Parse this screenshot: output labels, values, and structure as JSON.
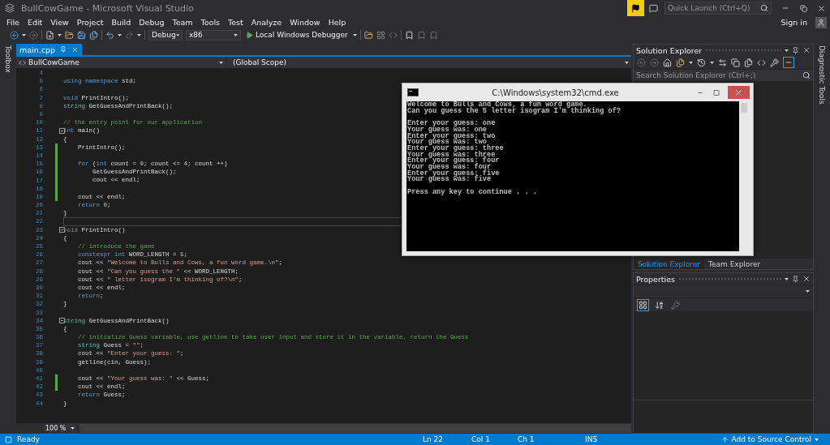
{
  "window": {
    "title": "BullCowGame - Microsoft Visual Studio"
  },
  "quick_launch": {
    "placeholder": "Quick Launch (Ctrl+Q)"
  },
  "sign_in": "Sign in",
  "menu": [
    "File",
    "Edit",
    "View",
    "Project",
    "Build",
    "Debug",
    "Team",
    "Tools",
    "Test",
    "Analyze",
    "Window",
    "Help"
  ],
  "toolbar": {
    "configuration": "Debug",
    "platform": "x86",
    "debugger": "Local Windows Debugger"
  },
  "side_tabs": {
    "left": "Toolbox",
    "right": "Diagnostic Tools"
  },
  "editor": {
    "tabs": [
      {
        "label": "main.cpp",
        "selected": true
      }
    ],
    "project": "BullCowGame",
    "scope": "(Global Scope)",
    "zoom": "100 %",
    "lines": [
      {
        "number": "4",
        "fold": false,
        "changed": false,
        "current": false
      },
      {
        "number": "5",
        "fold": false,
        "changed": false,
        "current": false,
        "tokens": [
          {
            "kind": "kw",
            "text": "using"
          },
          {
            "kind": "kw",
            "text": " namespace"
          },
          {
            "kind": "plain",
            "text": " std;"
          }
        ]
      },
      {
        "number": "6",
        "fold": false,
        "changed": false,
        "current": false
      },
      {
        "number": "7",
        "fold": false,
        "changed": false,
        "current": false,
        "tokens": [
          {
            "kind": "kw",
            "text": "void"
          },
          {
            "kind": "plain",
            "text": " PrintIntro();"
          }
        ]
      },
      {
        "number": "8",
        "fold": false,
        "changed": false,
        "current": false,
        "tokens": [
          {
            "kind": "type",
            "text": "string"
          },
          {
            "kind": "plain",
            "text": " GetGuessAndPrintBack();"
          }
        ]
      },
      {
        "number": "9",
        "fold": false,
        "changed": false,
        "current": false
      },
      {
        "number": "10",
        "fold": false,
        "changed": false,
        "current": false,
        "tokens": [
          {
            "kind": "comment",
            "text": "// the entry point for our application"
          }
        ]
      },
      {
        "number": "11",
        "fold": true,
        "changed": false,
        "current": false,
        "tokens": [
          {
            "kind": "kw",
            "text": "int"
          },
          {
            "kind": "plain",
            "text": " main()"
          }
        ]
      },
      {
        "number": "12",
        "fold": false,
        "changed": false,
        "current": false,
        "tokens": [
          {
            "kind": "plain",
            "text": "{"
          }
        ]
      },
      {
        "number": "13",
        "fold": false,
        "changed": true,
        "current": false,
        "tokens": [
          {
            "kind": "plain",
            "text": "    PrintIntro();"
          }
        ]
      },
      {
        "number": "14",
        "fold": false,
        "changed": true,
        "current": false
      },
      {
        "number": "15",
        "fold": false,
        "changed": true,
        "current": false,
        "tokens": [
          {
            "kind": "kw",
            "text": "    for"
          },
          {
            "kind": "plain",
            "text": " ("
          },
          {
            "kind": "kw",
            "text": "int"
          },
          {
            "kind": "plain",
            "text": " count = "
          },
          {
            "kind": "num",
            "text": "0"
          },
          {
            "kind": "plain",
            "text": "; count <= "
          },
          {
            "kind": "num",
            "text": "4"
          },
          {
            "kind": "plain",
            "text": "; count ++)"
          }
        ]
      },
      {
        "number": "16",
        "fold": false,
        "changed": true,
        "current": false,
        "tokens": [
          {
            "kind": "plain",
            "text": "        GetGuessAndPrintBack();"
          }
        ]
      },
      {
        "number": "17",
        "fold": false,
        "changed": true,
        "current": false,
        "tokens": [
          {
            "kind": "plain",
            "text": "        cout << endl;"
          }
        ]
      },
      {
        "number": "18",
        "fold": false,
        "changed": true,
        "current": false
      },
      {
        "number": "19",
        "fold": false,
        "changed": true,
        "current": false,
        "tokens": [
          {
            "kind": "plain",
            "text": "    cout << endl;"
          }
        ]
      },
      {
        "number": "20",
        "fold": false,
        "changed": false,
        "current": false,
        "tokens": [
          {
            "kind": "kw",
            "text": "    return"
          },
          {
            "kind": "num",
            "text": " 0"
          },
          {
            "kind": "plain",
            "text": ";"
          }
        ]
      },
      {
        "number": "21",
        "fold": false,
        "changed": false,
        "current": false,
        "tokens": [
          {
            "kind": "plain",
            "text": "}"
          }
        ]
      },
      {
        "number": "22",
        "fold": false,
        "changed": false,
        "current": true
      },
      {
        "number": "23",
        "fold": true,
        "changed": false,
        "current": false,
        "tokens": [
          {
            "kind": "kw",
            "text": "void"
          },
          {
            "kind": "plain",
            "text": " PrintIntro()"
          }
        ]
      },
      {
        "number": "24",
        "fold": false,
        "changed": false,
        "current": false,
        "tokens": [
          {
            "kind": "plain",
            "text": "{"
          }
        ]
      },
      {
        "number": "25",
        "fold": false,
        "changed": false,
        "current": false,
        "tokens": [
          {
            "kind": "comment",
            "text": "    // introduce the game"
          }
        ]
      },
      {
        "number": "26",
        "fold": false,
        "changed": false,
        "current": false,
        "tokens": [
          {
            "kind": "kw",
            "text": "    constexpr"
          },
          {
            "kind": "kw",
            "text": " int"
          },
          {
            "kind": "plain",
            "text": " WORD_LENGTH = "
          },
          {
            "kind": "num",
            "text": "5"
          },
          {
            "kind": "plain",
            "text": ";"
          }
        ]
      },
      {
        "number": "27",
        "fold": false,
        "changed": false,
        "current": false,
        "tokens": [
          {
            "kind": "plain",
            "text": "    cout << "
          },
          {
            "kind": "str",
            "text": "\"Welcome to Bulls and Cows, a fun word game.\\n\""
          },
          {
            "kind": "plain",
            "text": ";"
          }
        ]
      },
      {
        "number": "28",
        "fold": false,
        "changed": false,
        "current": false,
        "tokens": [
          {
            "kind": "plain",
            "text": "    cout << "
          },
          {
            "kind": "str",
            "text": "\"Can you guess the \""
          },
          {
            "kind": "plain",
            "text": " << WORD_LENGTH;"
          }
        ]
      },
      {
        "number": "29",
        "fold": false,
        "changed": false,
        "current": false,
        "tokens": [
          {
            "kind": "plain",
            "text": "    cout << "
          },
          {
            "kind": "str",
            "text": "\" letter isogram I'm thinking of?\\n\""
          },
          {
            "kind": "plain",
            "text": ";"
          }
        ]
      },
      {
        "number": "30",
        "fold": false,
        "changed": false,
        "current": false,
        "tokens": [
          {
            "kind": "plain",
            "text": "    cout << endl;"
          }
        ]
      },
      {
        "number": "31",
        "fold": false,
        "changed": false,
        "current": false,
        "tokens": [
          {
            "kind": "kw",
            "text": "    return"
          },
          {
            "kind": "plain",
            "text": ";"
          }
        ]
      },
      {
        "number": "32",
        "fold": false,
        "changed": false,
        "current": false,
        "tokens": [
          {
            "kind": "plain",
            "text": "}"
          }
        ]
      },
      {
        "number": "33",
        "fold": false,
        "changed": false,
        "current": false
      },
      {
        "number": "34",
        "fold": true,
        "changed": false,
        "current": false,
        "tokens": [
          {
            "kind": "type",
            "text": "string"
          },
          {
            "kind": "plain",
            "text": " GetGuessAndPrintBack()"
          }
        ]
      },
      {
        "number": "35",
        "fold": false,
        "changed": false,
        "current": false,
        "tokens": [
          {
            "kind": "plain",
            "text": "{"
          }
        ]
      },
      {
        "number": "36",
        "fold": false,
        "changed": false,
        "current": false,
        "tokens": [
          {
            "kind": "comment",
            "text": "    // initialize Guess variable, use getline to take user input and store it in the variable, return the Guess"
          }
        ]
      },
      {
        "number": "37",
        "fold": false,
        "changed": false,
        "current": false,
        "tokens": [
          {
            "kind": "type",
            "text": "    string"
          },
          {
            "kind": "plain",
            "text": " Guess = "
          },
          {
            "kind": "str",
            "text": "\"\""
          },
          {
            "kind": "plain",
            "text": ";"
          }
        ]
      },
      {
        "number": "38",
        "fold": false,
        "changed": false,
        "current": false,
        "tokens": [
          {
            "kind": "plain",
            "text": "    cout << "
          },
          {
            "kind": "str",
            "text": "\"Enter your guess: \""
          },
          {
            "kind": "plain",
            "text": ";"
          }
        ]
      },
      {
        "number": "39",
        "fold": false,
        "changed": false,
        "current": false,
        "tokens": [
          {
            "kind": "plain",
            "text": "    getline(cin, Guess);"
          }
        ]
      },
      {
        "number": "40",
        "fold": false,
        "changed": false,
        "current": false
      },
      {
        "number": "41",
        "fold": false,
        "changed": true,
        "current": false,
        "tokens": [
          {
            "kind": "plain",
            "text": "    cout << "
          },
          {
            "kind": "str",
            "text": "\"Your guess was: \""
          },
          {
            "kind": "plain",
            "text": " << Guess;"
          }
        ]
      },
      {
        "number": "42",
        "fold": false,
        "changed": true,
        "current": false,
        "tokens": [
          {
            "kind": "plain",
            "text": "    cout << endl;"
          }
        ]
      },
      {
        "number": "43",
        "fold": false,
        "changed": false,
        "current": false,
        "tokens": [
          {
            "kind": "kw",
            "text": "    return"
          },
          {
            "kind": "plain",
            "text": " Guess;"
          }
        ]
      },
      {
        "number": "44",
        "fold": false,
        "changed": false,
        "current": false,
        "tokens": [
          {
            "kind": "plain",
            "text": "}"
          }
        ]
      }
    ]
  },
  "solution_explorer": {
    "title": "Solution Explorer",
    "search": {
      "placeholder": "Search Solution Explorer (Ctrl+;)"
    },
    "tabs": [
      {
        "label": "Solution Explorer",
        "selected": true
      },
      {
        "label": "Team Explorer",
        "selected": false
      }
    ]
  },
  "properties": {
    "title": "Properties"
  },
  "console": {
    "title": "C:\\Windows\\system32\\cmd.exe",
    "blocks": [
      [
        "Welcome to Bulls and Cows, a fun word game.",
        "Can you guess the 5 letter isogram I'm thinking of?"
      ],
      [
        "Enter your guess: one",
        "Your guess was: one",
        "Enter your guess: two",
        "Your guess was: two",
        "Enter your guess: three",
        "Your guess was: three",
        "Enter your guess: four",
        "Your guess was: four",
        "Enter your guess: five",
        "Your guess was: five"
      ],
      [
        "Press any key to continue . . ."
      ]
    ]
  },
  "status_bar": {
    "state": "Ready",
    "line": "Ln 22",
    "column": "Col 1",
    "char": "Ch 1",
    "mode": "INS",
    "source_control": "Add to Source Control"
  }
}
